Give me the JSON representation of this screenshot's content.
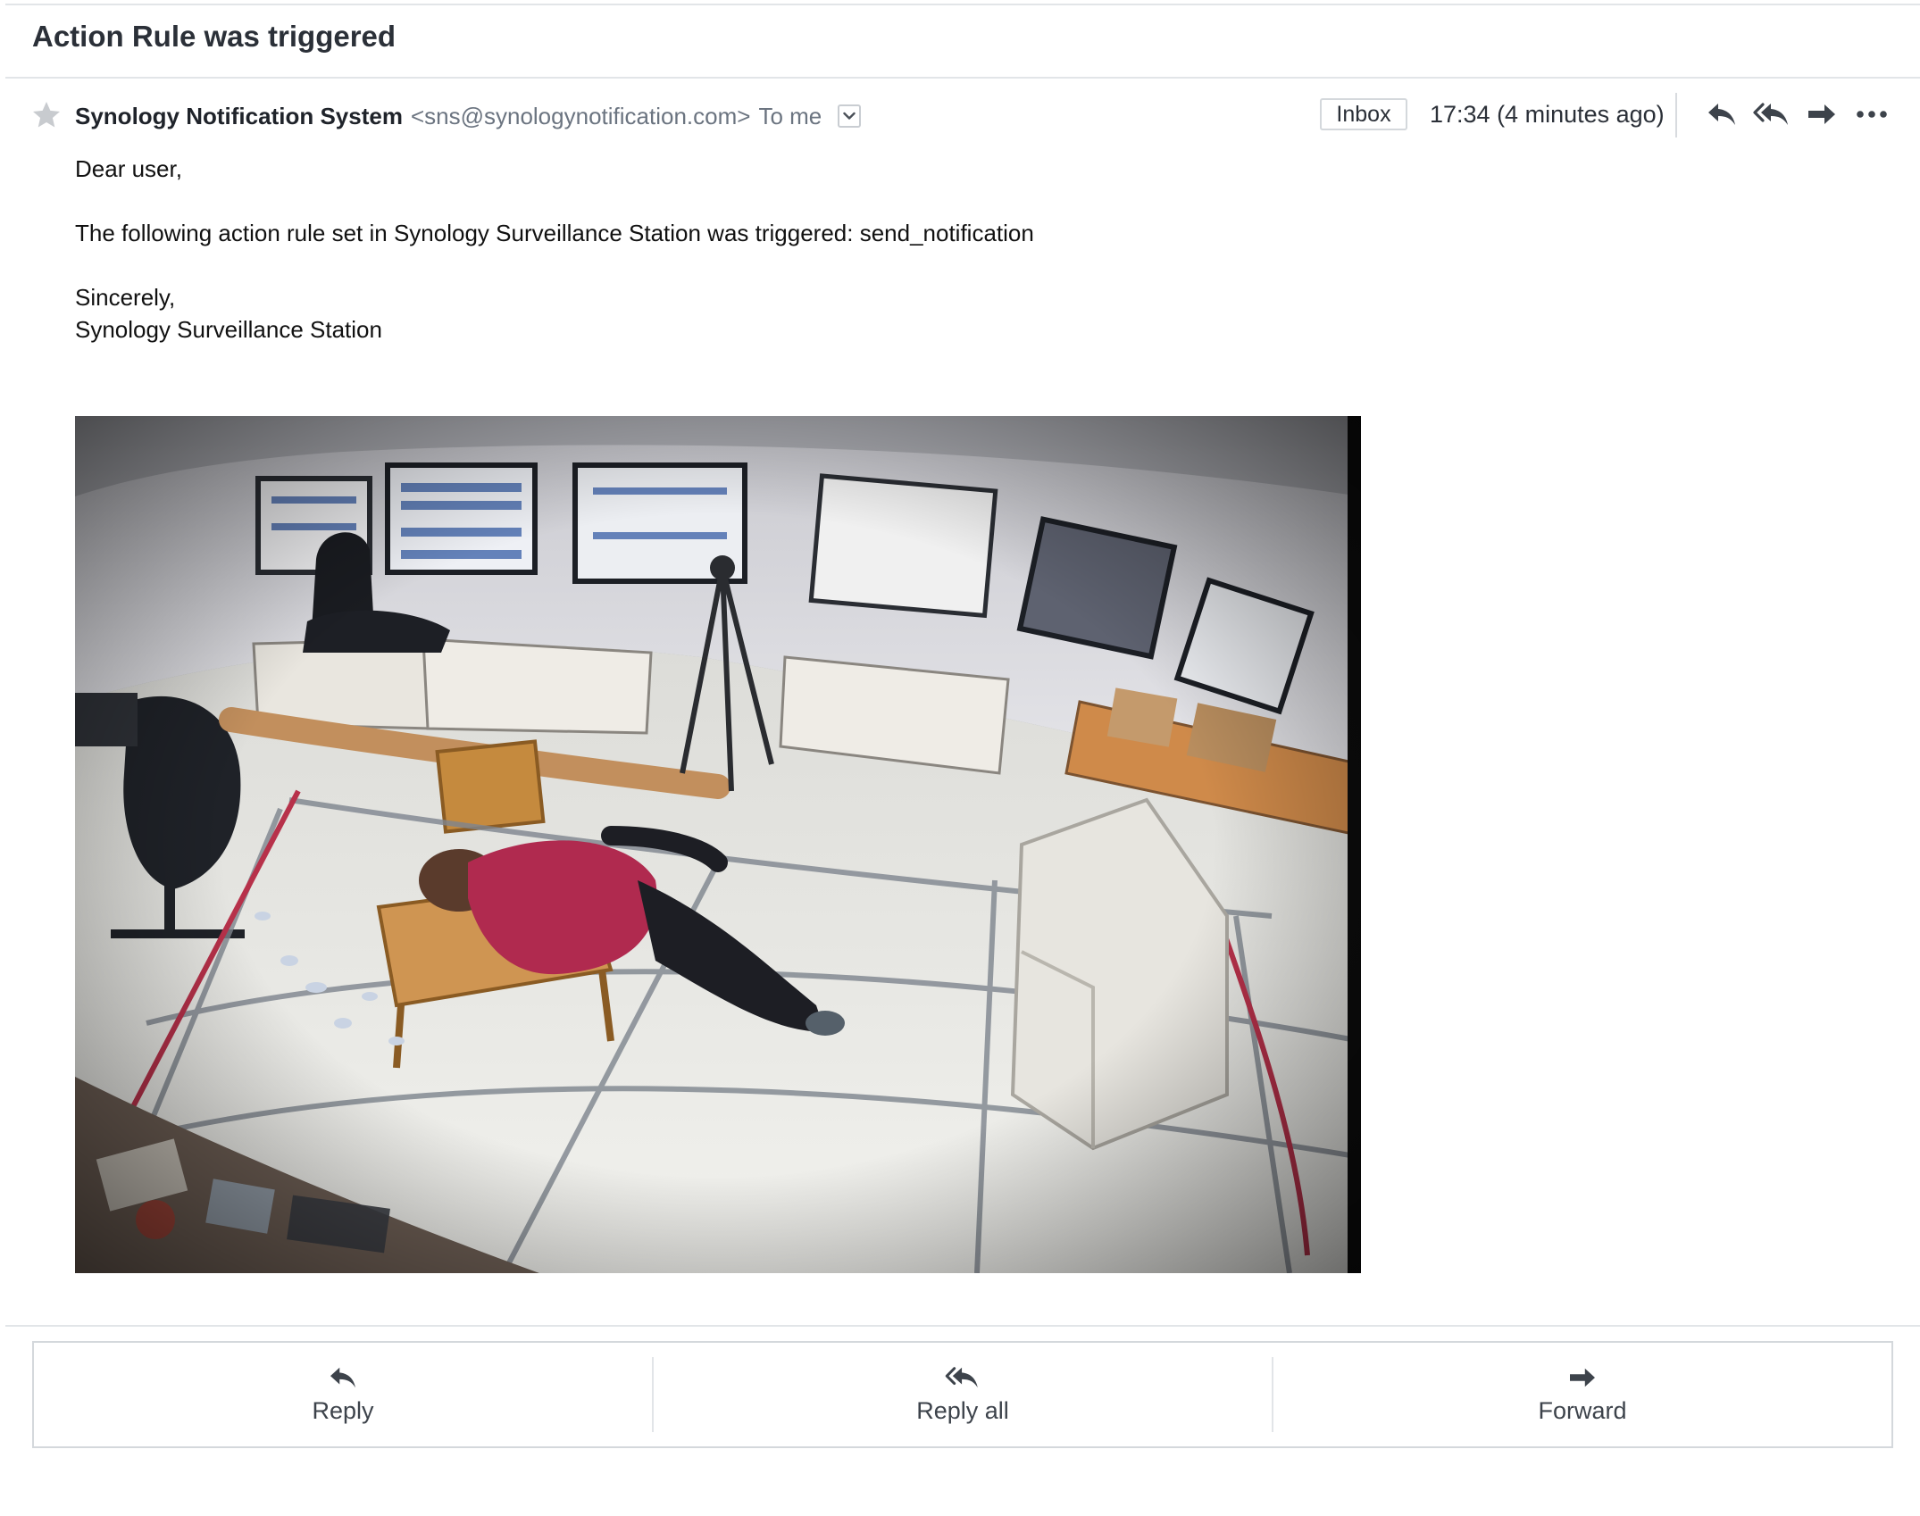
{
  "message": {
    "subject": "Action Rule was triggered",
    "sender_name": "Synology Notification System",
    "sender_email": "<sns@synologynotification.com>",
    "recipient": "To me",
    "folder_badge": "Inbox",
    "time": "17:34 (4 minutes ago)"
  },
  "body": {
    "greeting": "Dear user,",
    "line": "The following action rule set in Synology Surveillance Station was triggered: send_notification",
    "closing": "Sincerely,",
    "signature": "Synology Surveillance Station"
  },
  "header_actions": {
    "icons": [
      "star-icon",
      "chevron-down-icon",
      "reply-icon",
      "reply-all-icon",
      "forward-icon",
      "more-icon"
    ]
  },
  "footer_actions": {
    "reply_label": "Reply",
    "reply_all_label": "Reply all",
    "forward_label": "Forward"
  },
  "colors": {
    "text_primary": "#1f232a",
    "text_muted": "#6b7480",
    "border": "#d4d8dc",
    "icon": "#3d434b",
    "star": "#c8cbcf",
    "shirt": "#b02a4f"
  }
}
